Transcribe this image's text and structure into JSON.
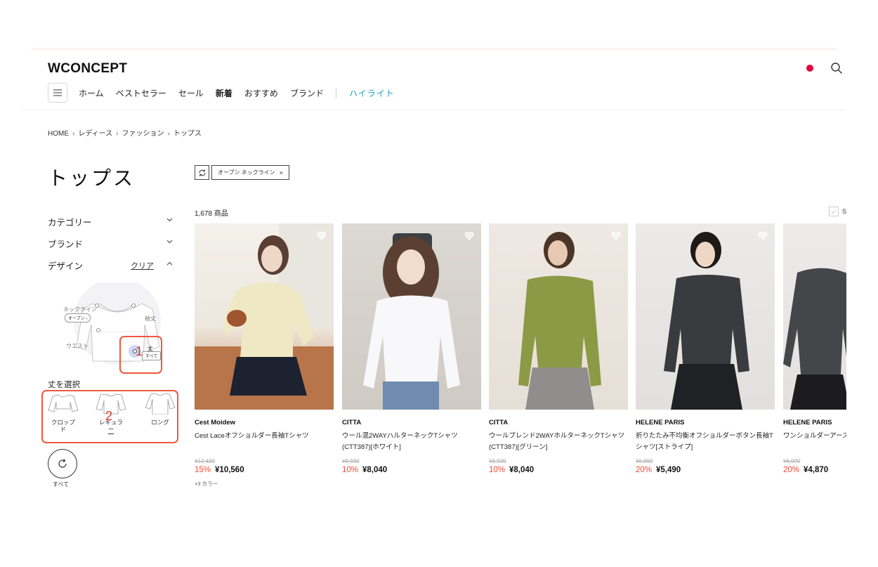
{
  "header": {
    "logo": "WCONCEPT",
    "nav": [
      "ホーム",
      "ベストセラー",
      "セール",
      "新着",
      "おすすめ",
      "ブランド"
    ],
    "highlight": "ハイライト",
    "accent_color": "#e5003f",
    "highlight_color": "#1e9ec7"
  },
  "breadcrumb": [
    "HOME",
    "レディース",
    "ファッション",
    "トップス"
  ],
  "page_title": "トップス",
  "filters": {
    "category": "カテゴリー",
    "brand": "ブランド",
    "design": "デザイン",
    "clear": "クリア",
    "diagram": {
      "neckline": "ネックライン",
      "neckline_value": "オープン",
      "sleeve": "袖丈",
      "waist": "ウエスト",
      "length": "丈",
      "length_value": "すべて"
    },
    "length_title": "丈を選択",
    "length_options": [
      "クロップド",
      "レギュラー",
      "ロング"
    ],
    "reset_label": "すべて"
  },
  "active_filter": "オープン ネックライン",
  "annotations": [
    "1",
    "2"
  ],
  "result_count": "1,678 商品",
  "sort_letter": "S",
  "products": [
    {
      "brand": "Cest Moidew",
      "name": "Cest Laceオフショルダー長袖Tシャツ",
      "orig": "¥12,430",
      "discount": "15%",
      "price": "¥10,560",
      "colors": "+3 カラー",
      "accent": "#e9e3c4"
    },
    {
      "brand": "CITTA",
      "name": "ウール混2WAYハルターネックTシャツ(CTT387)[ホワイト]",
      "orig": "¥8,930",
      "discount": "10%",
      "price": "¥8,040",
      "colors": "",
      "accent": "#f4f4f6"
    },
    {
      "brand": "CITTA",
      "name": "ウールブレンド2WAYホルターネックTシャツ(CTT387)[グリーン]",
      "orig": "¥8,930",
      "discount": "10%",
      "price": "¥8,040",
      "colors": "",
      "accent": "#8c9a45"
    },
    {
      "brand": "HELENE PARIS",
      "name": "折りたたみ不均衡オフショルダーボタン長袖Tシャツ[ストライプ]",
      "orig": "¥6,860",
      "discount": "20%",
      "price": "¥5,490",
      "colors": "",
      "accent": "#3a3b3f"
    },
    {
      "brand": "HELENE PARIS",
      "name": "ワンショルダーアースロングスリーブTシャツ",
      "orig": "¥6,090",
      "discount": "20%",
      "price": "¥4,870",
      "colors": "",
      "accent": "#45464a"
    }
  ]
}
